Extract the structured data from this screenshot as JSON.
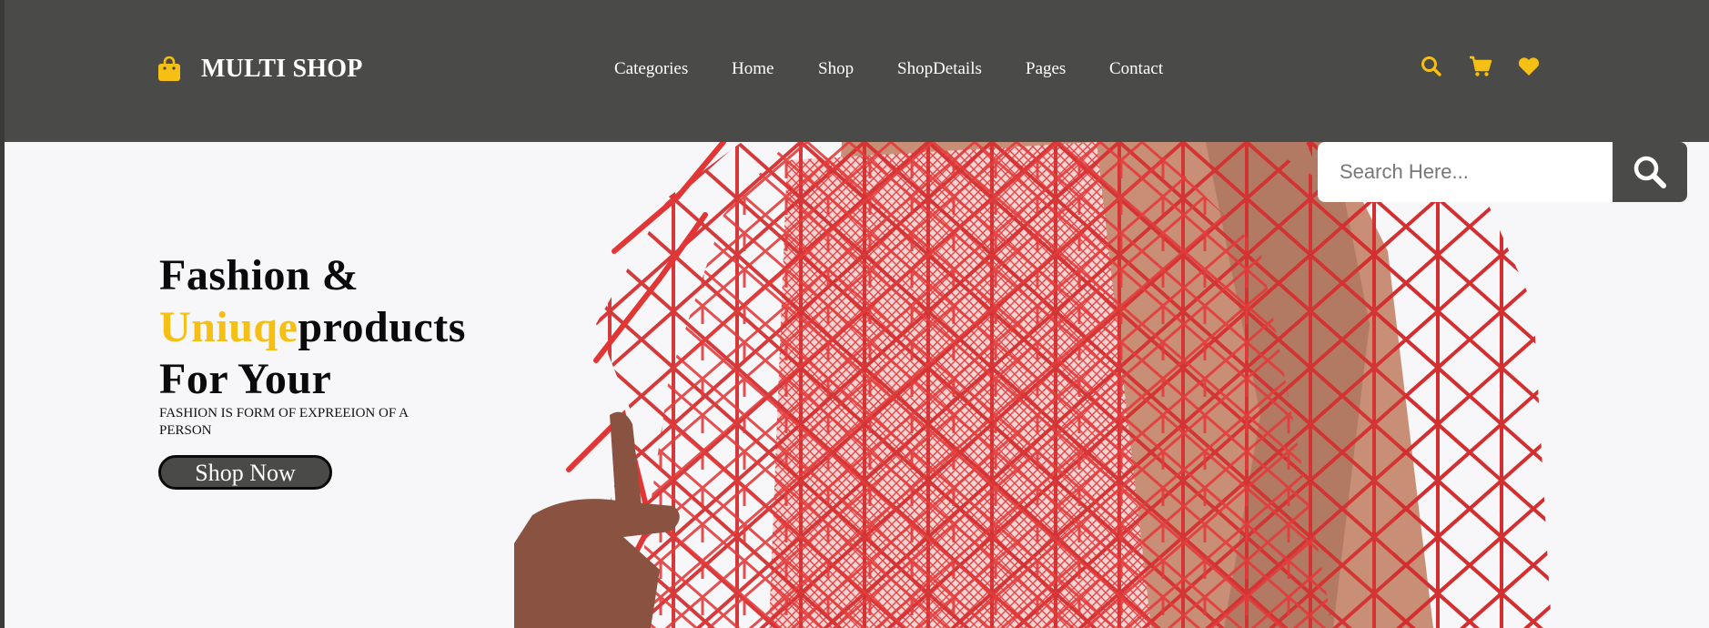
{
  "brand": {
    "name": "MULTI SHOP",
    "icon": "shopping-bag-icon"
  },
  "nav": {
    "items": [
      {
        "label": "Categories"
      },
      {
        "label": "Home"
      },
      {
        "label": "Shop"
      },
      {
        "label": "ShopDetails"
      },
      {
        "label": "Pages"
      },
      {
        "label": "Contact"
      }
    ]
  },
  "header_icons": [
    "search-icon",
    "cart-icon",
    "heart-icon"
  ],
  "hero": {
    "line1": "Fashion &",
    "line2_accent": "Uniuqe",
    "line2_rest": "products",
    "line3": "For Your",
    "tagline": "FASHION IS FORM OF EXPREEION OF A PERSON",
    "button_label": "Shop Now"
  },
  "search": {
    "placeholder": "Search Here...",
    "icon": "search-icon"
  },
  "colors": {
    "header_bg": "#4a4a48",
    "accent": "#f5bf13",
    "hero_bg": "#f7f6f8",
    "garment": "#e53a3a"
  }
}
